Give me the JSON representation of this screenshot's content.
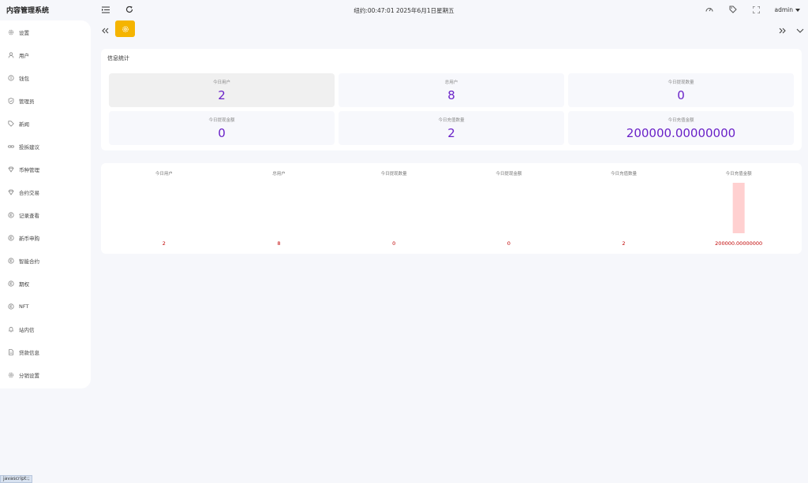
{
  "header": {
    "app_title": "内容管理系统",
    "clock": "纽约:00:47:01 2025年6月1日星期五",
    "user": "admin"
  },
  "sidebar": {
    "items": [
      {
        "label": "设置",
        "icon": "gear-icon"
      },
      {
        "label": "用户",
        "icon": "user-icon"
      },
      {
        "label": "钱包",
        "icon": "coin-icon"
      },
      {
        "label": "管理员",
        "icon": "shield-icon"
      },
      {
        "label": "新闻",
        "icon": "tag-icon"
      },
      {
        "label": "投拆建议",
        "icon": "link-icon"
      },
      {
        "label": "币种管理",
        "icon": "diamond-icon"
      },
      {
        "label": "合约交易",
        "icon": "diamond-icon"
      },
      {
        "label": "记录查看",
        "icon": "circle-e-icon"
      },
      {
        "label": "新币申购",
        "icon": "circle-e-icon"
      },
      {
        "label": "智能合约",
        "icon": "circle-e-icon"
      },
      {
        "label": "期权",
        "icon": "circle-e-icon"
      },
      {
        "label": "NFT",
        "icon": "circle-e-icon"
      },
      {
        "label": "站内信",
        "icon": "bell-icon"
      },
      {
        "label": "贷款信息",
        "icon": "document-icon"
      },
      {
        "label": "分销设置",
        "icon": "gear-icon"
      }
    ]
  },
  "stats": {
    "title": "信息统计",
    "items": [
      {
        "label": "今日用户",
        "value": "2"
      },
      {
        "label": "总用户",
        "value": "8"
      },
      {
        "label": "今日提现数量",
        "value": "0"
      },
      {
        "label": "今日提现金额",
        "value": "0"
      },
      {
        "label": "今日充值数量",
        "value": "2"
      },
      {
        "label": "今日充值金额",
        "value": "200000.00000000"
      }
    ]
  },
  "chart_data": {
    "type": "bar",
    "categories": [
      "今日用户",
      "总用户",
      "今日提现数量",
      "今日提现金额",
      "今日充值数量",
      "今日充值金额"
    ],
    "values": [
      2,
      8,
      0,
      0,
      2,
      200000
    ],
    "value_labels": [
      "2",
      "8",
      "0",
      "0",
      "2",
      "200000.00000000"
    ],
    "bar_color": "#ffd0d0",
    "label_color": "#c00000",
    "grid": false
  },
  "status_bar": {
    "text": "javascript:;"
  },
  "colors": {
    "accent": "#f5b400",
    "value": "#6a22c8"
  }
}
